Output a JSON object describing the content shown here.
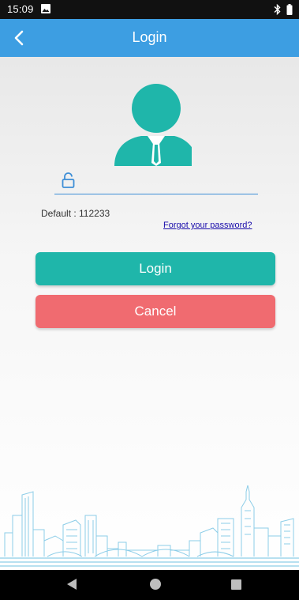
{
  "status_bar": {
    "time": "15:09",
    "left_icons": [
      "gallery-icon"
    ],
    "right_icons": [
      "bluetooth-icon",
      "battery-icon"
    ]
  },
  "app_bar": {
    "title": "Login",
    "back_icon": "chevron-left-icon",
    "color": "#3d9ee2"
  },
  "login_form": {
    "avatar_icon": "user-avatar-icon",
    "password_icon": "unlock-icon",
    "password_value": "",
    "default_hint": "Default : 112233",
    "forgot_link": "Forgot your password?",
    "login_label": "Login",
    "cancel_label": "Cancel"
  },
  "colors": {
    "accent": "#1fb6aa",
    "cancel": "#f06b70",
    "link": "#1a0dab",
    "app_bar": "#3d9ee2"
  },
  "nav_bar": {
    "icons": [
      "back-triangle-icon",
      "home-circle-icon",
      "recents-square-icon"
    ]
  }
}
